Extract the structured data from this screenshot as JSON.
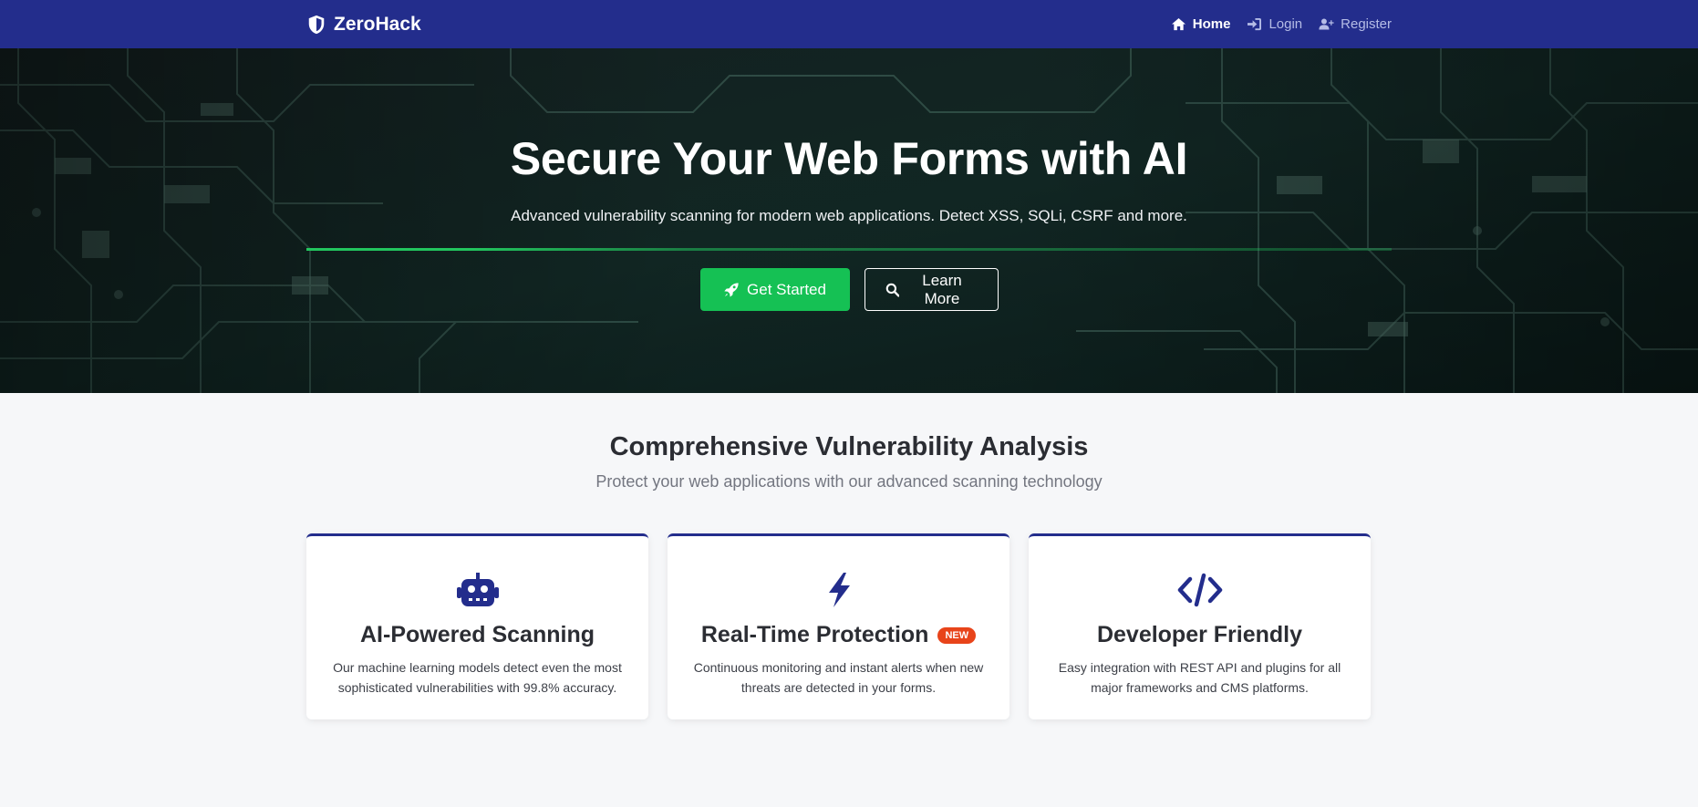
{
  "nav": {
    "brand": "ZeroHack",
    "links": [
      {
        "label": "Home",
        "icon": "home-icon",
        "active": true
      },
      {
        "label": "Login",
        "icon": "login-icon",
        "active": false
      },
      {
        "label": "Register",
        "icon": "user-plus-icon",
        "active": false
      }
    ]
  },
  "hero": {
    "title": "Secure Your Web Forms with AI",
    "subtitle": "Advanced vulnerability scanning for modern web applications. Detect XSS, SQLi, CSRF and more.",
    "primary_button": "Get Started",
    "secondary_button": "Learn More"
  },
  "features": {
    "title": "Comprehensive Vulnerability Analysis",
    "subtitle": "Protect your web applications with our advanced scanning technology",
    "cards": [
      {
        "icon": "robot-icon",
        "title": "AI-Powered Scanning",
        "badge": "",
        "text": "Our machine learning models detect even the most sophisticated vulnerabilities with 99.8% accuracy."
      },
      {
        "icon": "bolt-icon",
        "title": "Real-Time Protection",
        "badge": "NEW",
        "text": "Continuous monitoring and instant alerts when new threats are detected in your forms."
      },
      {
        "icon": "code-icon",
        "title": "Developer Friendly",
        "badge": "",
        "text": "Easy integration with REST API and plugins for all major frameworks and CMS platforms."
      }
    ]
  },
  "colors": {
    "navbar": "#232d8c",
    "accent_green": "#15c154",
    "badge": "#e8441a",
    "card_border": "#232d8c"
  }
}
